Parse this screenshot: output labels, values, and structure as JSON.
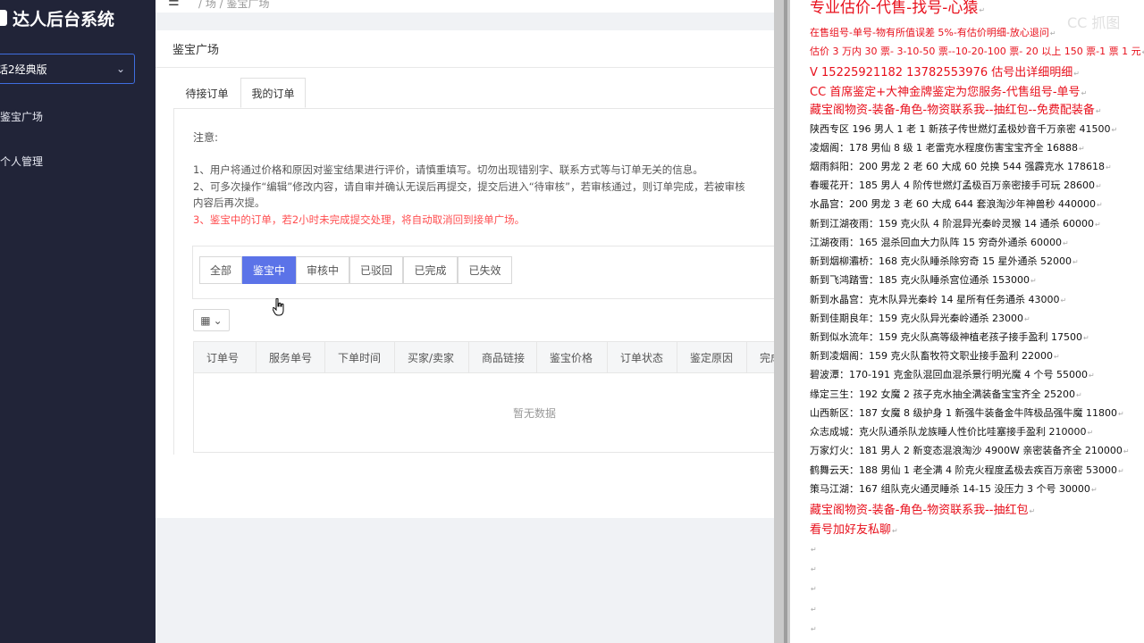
{
  "sidebar": {
    "brand": "达人后台系统",
    "version": "话2经典版",
    "items": [
      {
        "label": "鉴宝广场"
      },
      {
        "label": "个人管理"
      }
    ]
  },
  "topbar": {
    "breadcrumb": "/ 场 / 鉴宝广场"
  },
  "card": {
    "title": "鉴宝广场",
    "tabs": [
      {
        "label": "待接订单"
      },
      {
        "label": "我的订单"
      }
    ],
    "notes": {
      "title": "注意:",
      "line1": "1、用户将通过价格和原因对鉴宝结果进行评价，请慎重填写。切勿出现错别字、联系方式等与订单无关的信息。",
      "line2": "2、可多次操作“编辑”修改内容，请自审并确认无误后再提交，提交后进入“待审核”，若审核通过，则订单完成，若被审核",
      "line3": "内容后再次提。",
      "line4": "3、鉴宝中的订单，若2小时未完成提交处理，将自动取消回到接单广场。"
    },
    "filters": [
      "全部",
      "鉴宝中",
      "审核中",
      "已驳回",
      "已完成",
      "已失效"
    ],
    "active_filter": "鉴宝中",
    "columns": [
      "订单号",
      "服务单号",
      "下单时间",
      "买家/卖家",
      "商品链接",
      "鉴宝价格",
      "订单状态",
      "鉴定原因",
      "完成"
    ],
    "empty_text": "暂无数据"
  },
  "doc": {
    "watermark": "CC 抓图",
    "lines": [
      {
        "text": "专业估价-代售-找号-心猿",
        "color": "red"
      },
      {
        "text": "在售组号-单号-物有所值误差 5%-有估价明细-放心退问",
        "color": "red"
      },
      {
        "text": "估价 3 万内 30 票- 3-10-50 票--10-20-100 票- 20 以上 150 票-1 票 1 元",
        "color": "red"
      },
      {
        "text": "V 15225921182      13782553976   估号出详细明细",
        "color": "red"
      },
      {
        "text": "CC 首席鉴定+大神金牌鉴定为您服务-代售组号-单号",
        "color": "red"
      },
      {
        "text": "藏宝阁物资-装备-角色-物资联系我--抽红包--免费配装备",
        "color": "red"
      },
      {
        "text": "陕西专区 196 男人 1 老 1 新孩子传世燃灯孟极妙音千万亲密 41500",
        "color": "black"
      },
      {
        "text": "凌烟阁：178 男仙 8 级 1 老雷克水程度伤害宝宝齐全 16888",
        "color": "black"
      },
      {
        "text": "烟雨斜阳：200 男龙 2 老 60 大成 60 兑换 544 强霹克水 178618",
        "color": "black"
      },
      {
        "text": "春暖花开：185 男人 4 阶传世燃灯孟极百万亲密接手可玩 28600",
        "color": "black"
      },
      {
        "text": "水晶宫：200 男龙 3 老 60 大成 644 套浪淘沙年神兽秒 440000",
        "color": "black"
      },
      {
        "text": "新到江湖夜雨：159 克火队 4 阶混异光秦岭灵猴 14 通杀 60000",
        "color": "black"
      },
      {
        "text": "江湖夜雨：165 混杀回血大力队阵 15 穷奇外通杀 60000",
        "color": "black"
      },
      {
        "text": "新到烟柳灞桥：168 克火队睡杀除穷奇 15 星外通杀 52000",
        "color": "black"
      },
      {
        "text": "新到飞鸿踏雪：185 克火队睡杀宫位通杀 153000",
        "color": "black"
      },
      {
        "text": "新到水晶宫：克木队异光秦岭 14 星所有任务通杀 43000",
        "color": "black"
      },
      {
        "text": "新到佳期良年：159 克火队异光秦岭通杀 23000",
        "color": "black"
      },
      {
        "text": "新到似水流年：159 克火队高等级神植老孩子接手盈利 17500",
        "color": "black"
      },
      {
        "text": "新到凌烟阁：159 克火队畜牧符文职业接手盈利 22000",
        "color": "black"
      },
      {
        "text": "碧波潭：170-191 克金队混回血混杀景行明光魔 4 个号 55000",
        "color": "black"
      },
      {
        "text": "缘定三生：192 女魔 2 孩子克水抽全满装备宝宝齐全 25200",
        "color": "black"
      },
      {
        "text": "山西新区：187 女魔 8 级护身 1 新强牛装备金牛阵极品强牛魔 11800",
        "color": "black"
      },
      {
        "text": "众志成城：克火队通杀队龙族睡人性价比哇塞接手盈利 210000",
        "color": "black"
      },
      {
        "text": "万家灯火：181 男人 2 新变态混浪淘沙 4900W 亲密装备齐全 210000",
        "color": "black"
      },
      {
        "text": "鹤舞云天：188 男仙 1 老全满 4 阶克火程度孟极去疾百万亲密 53000",
        "color": "black"
      },
      {
        "text": "策马江湖：167 组队克火通灵睡杀 14-15 没压力 3 个号 30000",
        "color": "black"
      },
      {
        "text": "藏宝阁物资-装备-角色-物资联系我--抽红包",
        "color": "red"
      },
      {
        "text": "看号加好友私聊",
        "color": "red"
      }
    ]
  }
}
